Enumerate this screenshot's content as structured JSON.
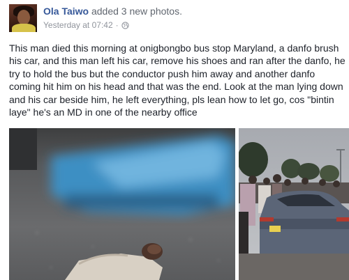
{
  "post": {
    "author": "Ola Taiwo",
    "action": "added 3 new photos.",
    "timestamp": "Yesterday at 07:42",
    "separator": "·",
    "privacy_icon": "globe-icon",
    "text": "This man died this morning at onigbongbo bus stop Maryland, a danfo brush his car, and this man left his car, remove his shoes and ran after the danfo, he try to hold the bus but the conductor push him away and another danfo coming hit him on his head and that was the end. Look at the man lying down and his car beside him, he left everything, pls lean how to let go, cos \"bintin laye\" he's an MD in one of the nearby office"
  },
  "colors": {
    "author": "#365899",
    "text": "#1d2129",
    "meta": "#90949c"
  }
}
